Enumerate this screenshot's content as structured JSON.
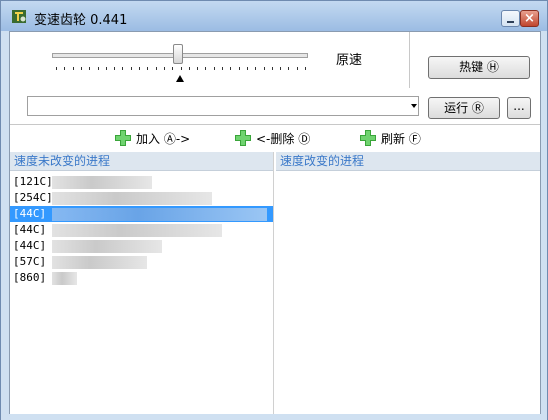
{
  "window": {
    "title": "变速齿轮 0.441"
  },
  "speed": {
    "label": "原速"
  },
  "buttons": {
    "hotkey": "热键 Ⓗ",
    "run": "运行 Ⓡ",
    "more": "..."
  },
  "process_combo": {
    "value": ""
  },
  "actions": {
    "add": "加入 Ⓐ->",
    "remove": "<-删除 Ⓓ",
    "refresh": "刷新 Ⓕ"
  },
  "lists": {
    "unchanged_header": "速度未改变的进程",
    "changed_header": "速度改变的进程",
    "unchanged_items": [
      {
        "label": "[121C]",
        "selected": false
      },
      {
        "label": "[254C]",
        "selected": false
      },
      {
        "label": "[44C]",
        "selected": true
      },
      {
        "label": "[44C]",
        "selected": false
      },
      {
        "label": "[44C]",
        "selected": false
      },
      {
        "label": "[57C]",
        "selected": false
      },
      {
        "label": "[860]",
        "selected": false
      }
    ]
  },
  "colors": {
    "accent": "#3399ff",
    "header_text": "#3b79c9",
    "title_bar": "#c3d9f1"
  }
}
